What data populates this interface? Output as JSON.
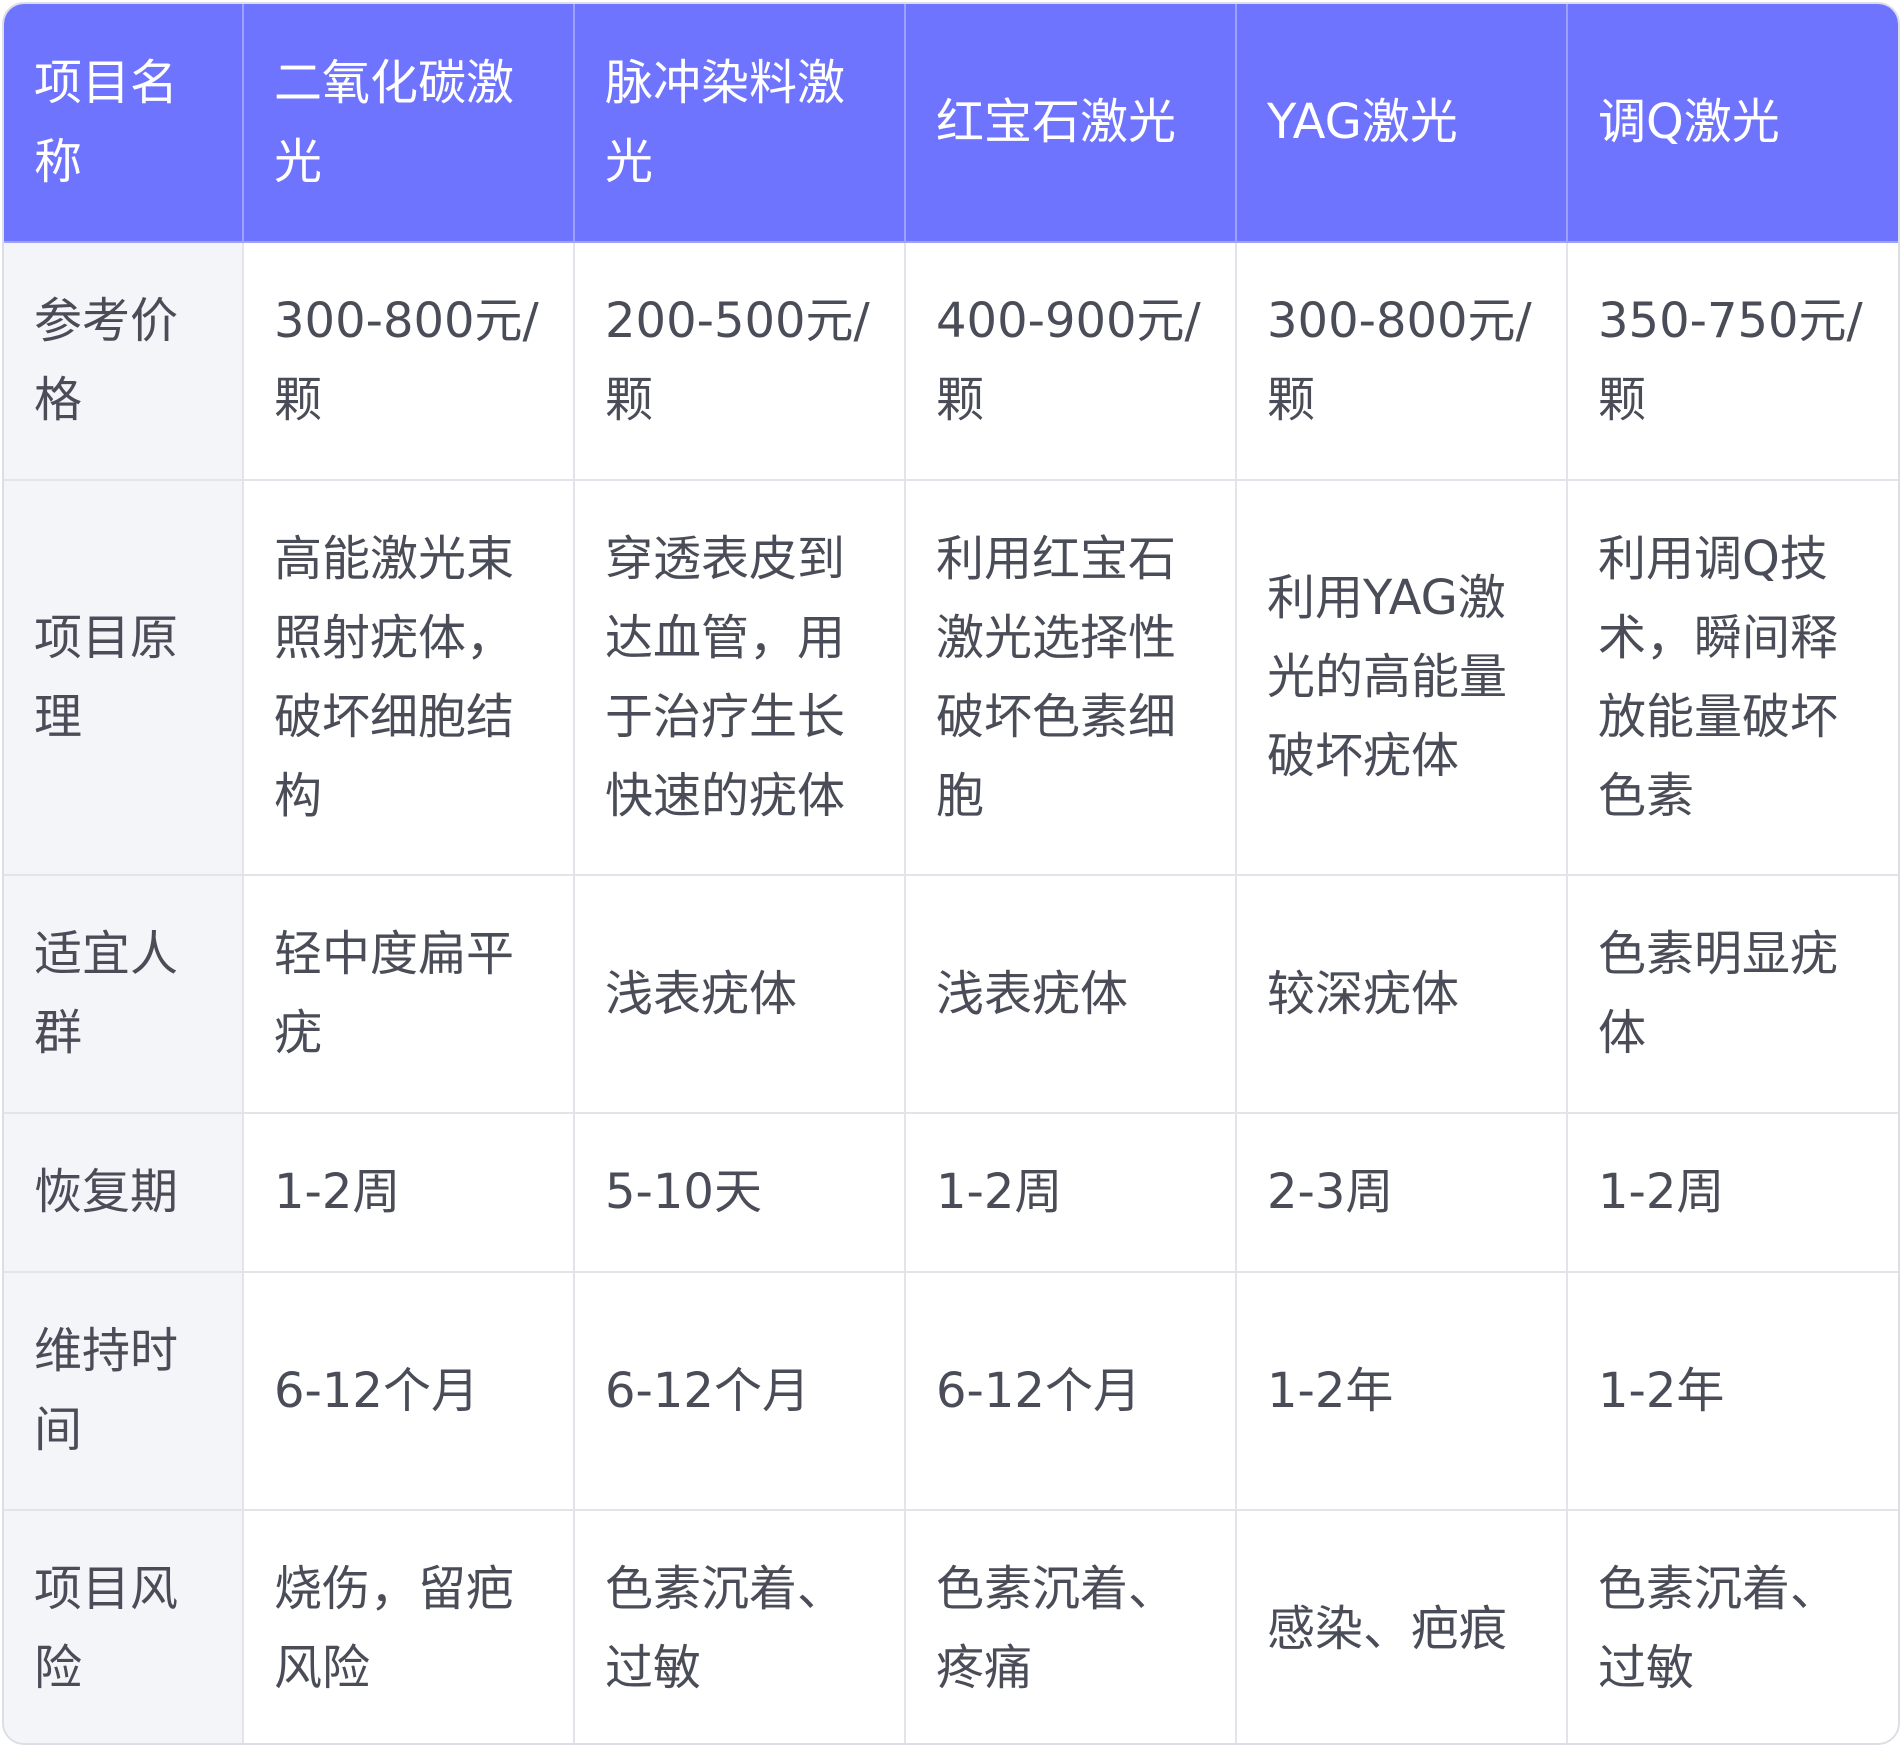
{
  "table": {
    "header": [
      "项目名称",
      "二氧化碳激光",
      "脉冲染料激光",
      "红宝石激光",
      "YAG激光",
      "调Q激光"
    ],
    "rows": [
      {
        "label": "参考价格",
        "cells": [
          "300-800元/颗",
          "200-500元/颗",
          "400-900元/颗",
          "300-800元/颗",
          "350-750元/颗"
        ]
      },
      {
        "label": "项目原理",
        "cells": [
          "高能激光束照射疣体，破坏细胞结构",
          "穿透表皮到达血管，用于治疗生长快速的疣体",
          "利用红宝石激光选择性破坏色素细胞",
          "利用YAG激光的高能量破坏疣体",
          "利用调Q技术，瞬间释放能量破坏色素"
        ]
      },
      {
        "label": "适宜人群",
        "cells": [
          "轻中度扁平疣",
          "浅表疣体",
          "浅表疣体",
          "较深疣体",
          "色素明显疣体"
        ]
      },
      {
        "label": "恢复期",
        "cells": [
          "1-2周",
          "5-10天",
          "1-2周",
          "2-3周",
          "1-2周"
        ]
      },
      {
        "label": "维持时间",
        "cells": [
          "6-12个月",
          "6-12个月",
          "6-12个月",
          "1-2年",
          "1-2年"
        ]
      },
      {
        "label": "项目风险",
        "cells": [
          "烧伤，留疤风险",
          "色素沉着、过敏",
          "色素沉着、疼痛",
          "感染、疤痕",
          "色素沉着、过敏"
        ]
      }
    ]
  },
  "colors": {
    "header_bg": "#6f74fe",
    "header_text": "#ffffff",
    "label_bg": "#f4f5f9",
    "text": "#4a4d58",
    "grid": "#e2e4ea"
  }
}
